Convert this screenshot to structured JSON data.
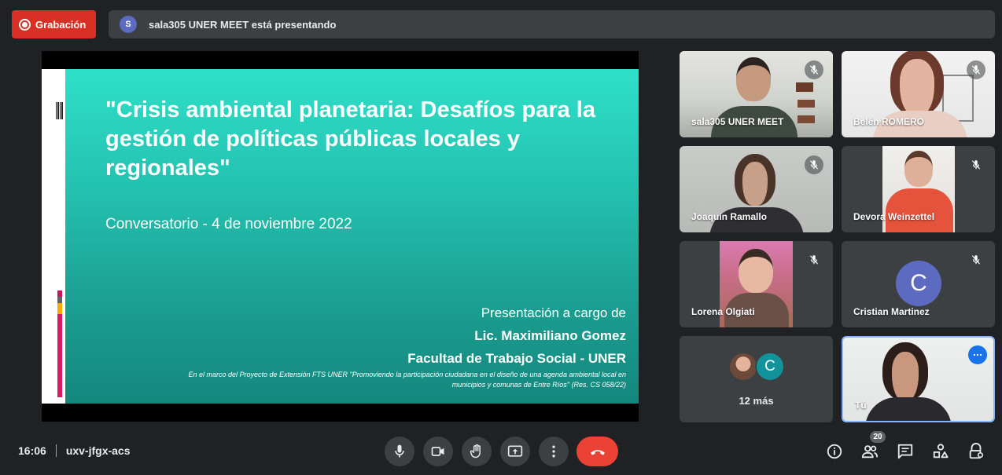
{
  "top": {
    "recording_label": "Grabación",
    "presenter_initial": "S",
    "presenting_text": "sala305 UNER MEET está presentando"
  },
  "slide": {
    "title": "\"Crisis ambiental planetaria: Desafíos para la gestión de políticas públicas locales y regionales\"",
    "subtitle": "Conversatorio - 4 de noviembre 2022",
    "credit_intro": "Presentación a cargo de",
    "presenter": "Lic. Maximiliano Gomez",
    "faculty": "Facultad de Trabajo Social - UNER",
    "footnote_line1": "En el marco del Proyecto de Extensión FTS UNER \"Promoviendo la participación ciudadana en el diseño de una agenda ambiental local en",
    "footnote_line2": "municipios y comunas de Entre Ríos\" (Res. CS 058/22)"
  },
  "participants": [
    {
      "name": "sala305 UNER MEET",
      "muted": true
    },
    {
      "name": "Belén ROMERO",
      "muted": true
    },
    {
      "name": "Joaquín Ramallo",
      "muted": true
    },
    {
      "name": "Devora Weinzettel",
      "muted": true
    },
    {
      "name": "Lorena Olgiati",
      "muted": true
    },
    {
      "name": "Cristian Martinez",
      "muted": true,
      "initial": "C"
    }
  ],
  "more_tile": {
    "initial": "C",
    "label": "12 más"
  },
  "self_tile": {
    "name": "Tú"
  },
  "bottom": {
    "time": "16:06",
    "meeting_code": "uxv-jfgx-acs",
    "participant_count": "20"
  },
  "colors": {
    "recording": "#d93025",
    "hangup": "#ea4335",
    "avatar": "#5c6bc0",
    "self_border": "#8ab4f8",
    "slide_teal": "#24c2b0"
  }
}
